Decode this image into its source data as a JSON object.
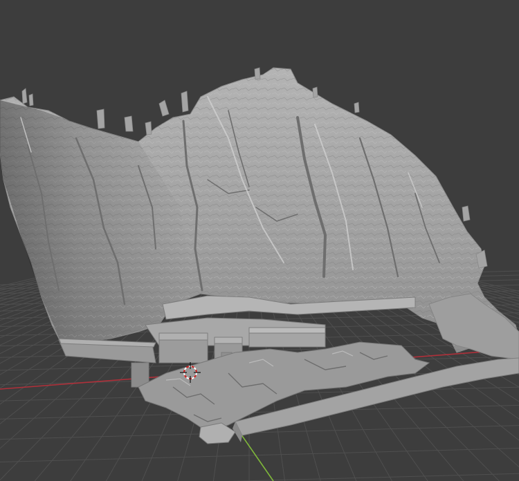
{
  "viewport": {
    "background": "#3d3d3d",
    "grid_color": "#4f4f4f",
    "x_axis_color": "#b0303a",
    "y_axis_color": "#7fb83a",
    "mesh_color": "#a9a9a9",
    "cursor_colors": [
      "#d02020",
      "#ffffff"
    ],
    "icons": [
      "3d-cursor-icon"
    ]
  }
}
